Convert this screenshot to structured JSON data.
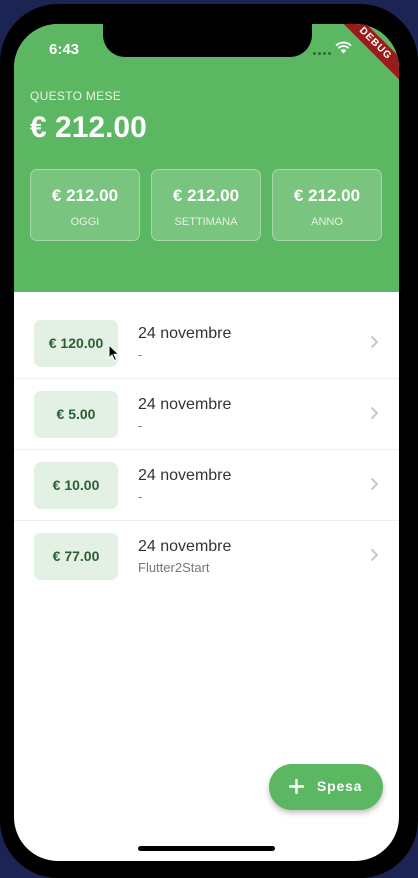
{
  "status_bar": {
    "time": "6:43",
    "debug_label": "DEBUG",
    "wifi_icon": "wifi-icon"
  },
  "summary": {
    "month_label": "QUESTO MESE",
    "month_total": "€ 212.00",
    "cards": [
      {
        "amount": "€ 212.00",
        "label": "OGGI"
      },
      {
        "amount": "€ 212.00",
        "label": "SETTIMANA"
      },
      {
        "amount": "€ 212.00",
        "label": "ANNO"
      }
    ]
  },
  "expenses": [
    {
      "amount": "€ 120.00",
      "date": "24 novembre",
      "note": "-"
    },
    {
      "amount": "€ 5.00",
      "date": "24 novembre",
      "note": "-"
    },
    {
      "amount": "€ 10.00",
      "date": "24 novembre",
      "note": "-"
    },
    {
      "amount": "€ 77.00",
      "date": "24 novembre",
      "note": "Flutter2Start"
    }
  ],
  "fab": {
    "label": "Spesa",
    "icon": "plus-icon"
  },
  "colors": {
    "primary": "#5cb763",
    "badge_bg": "#e3f1e4",
    "badge_text": "#2c5e33",
    "page_bg": "#1b2452",
    "debug": "#9a1b1b"
  }
}
